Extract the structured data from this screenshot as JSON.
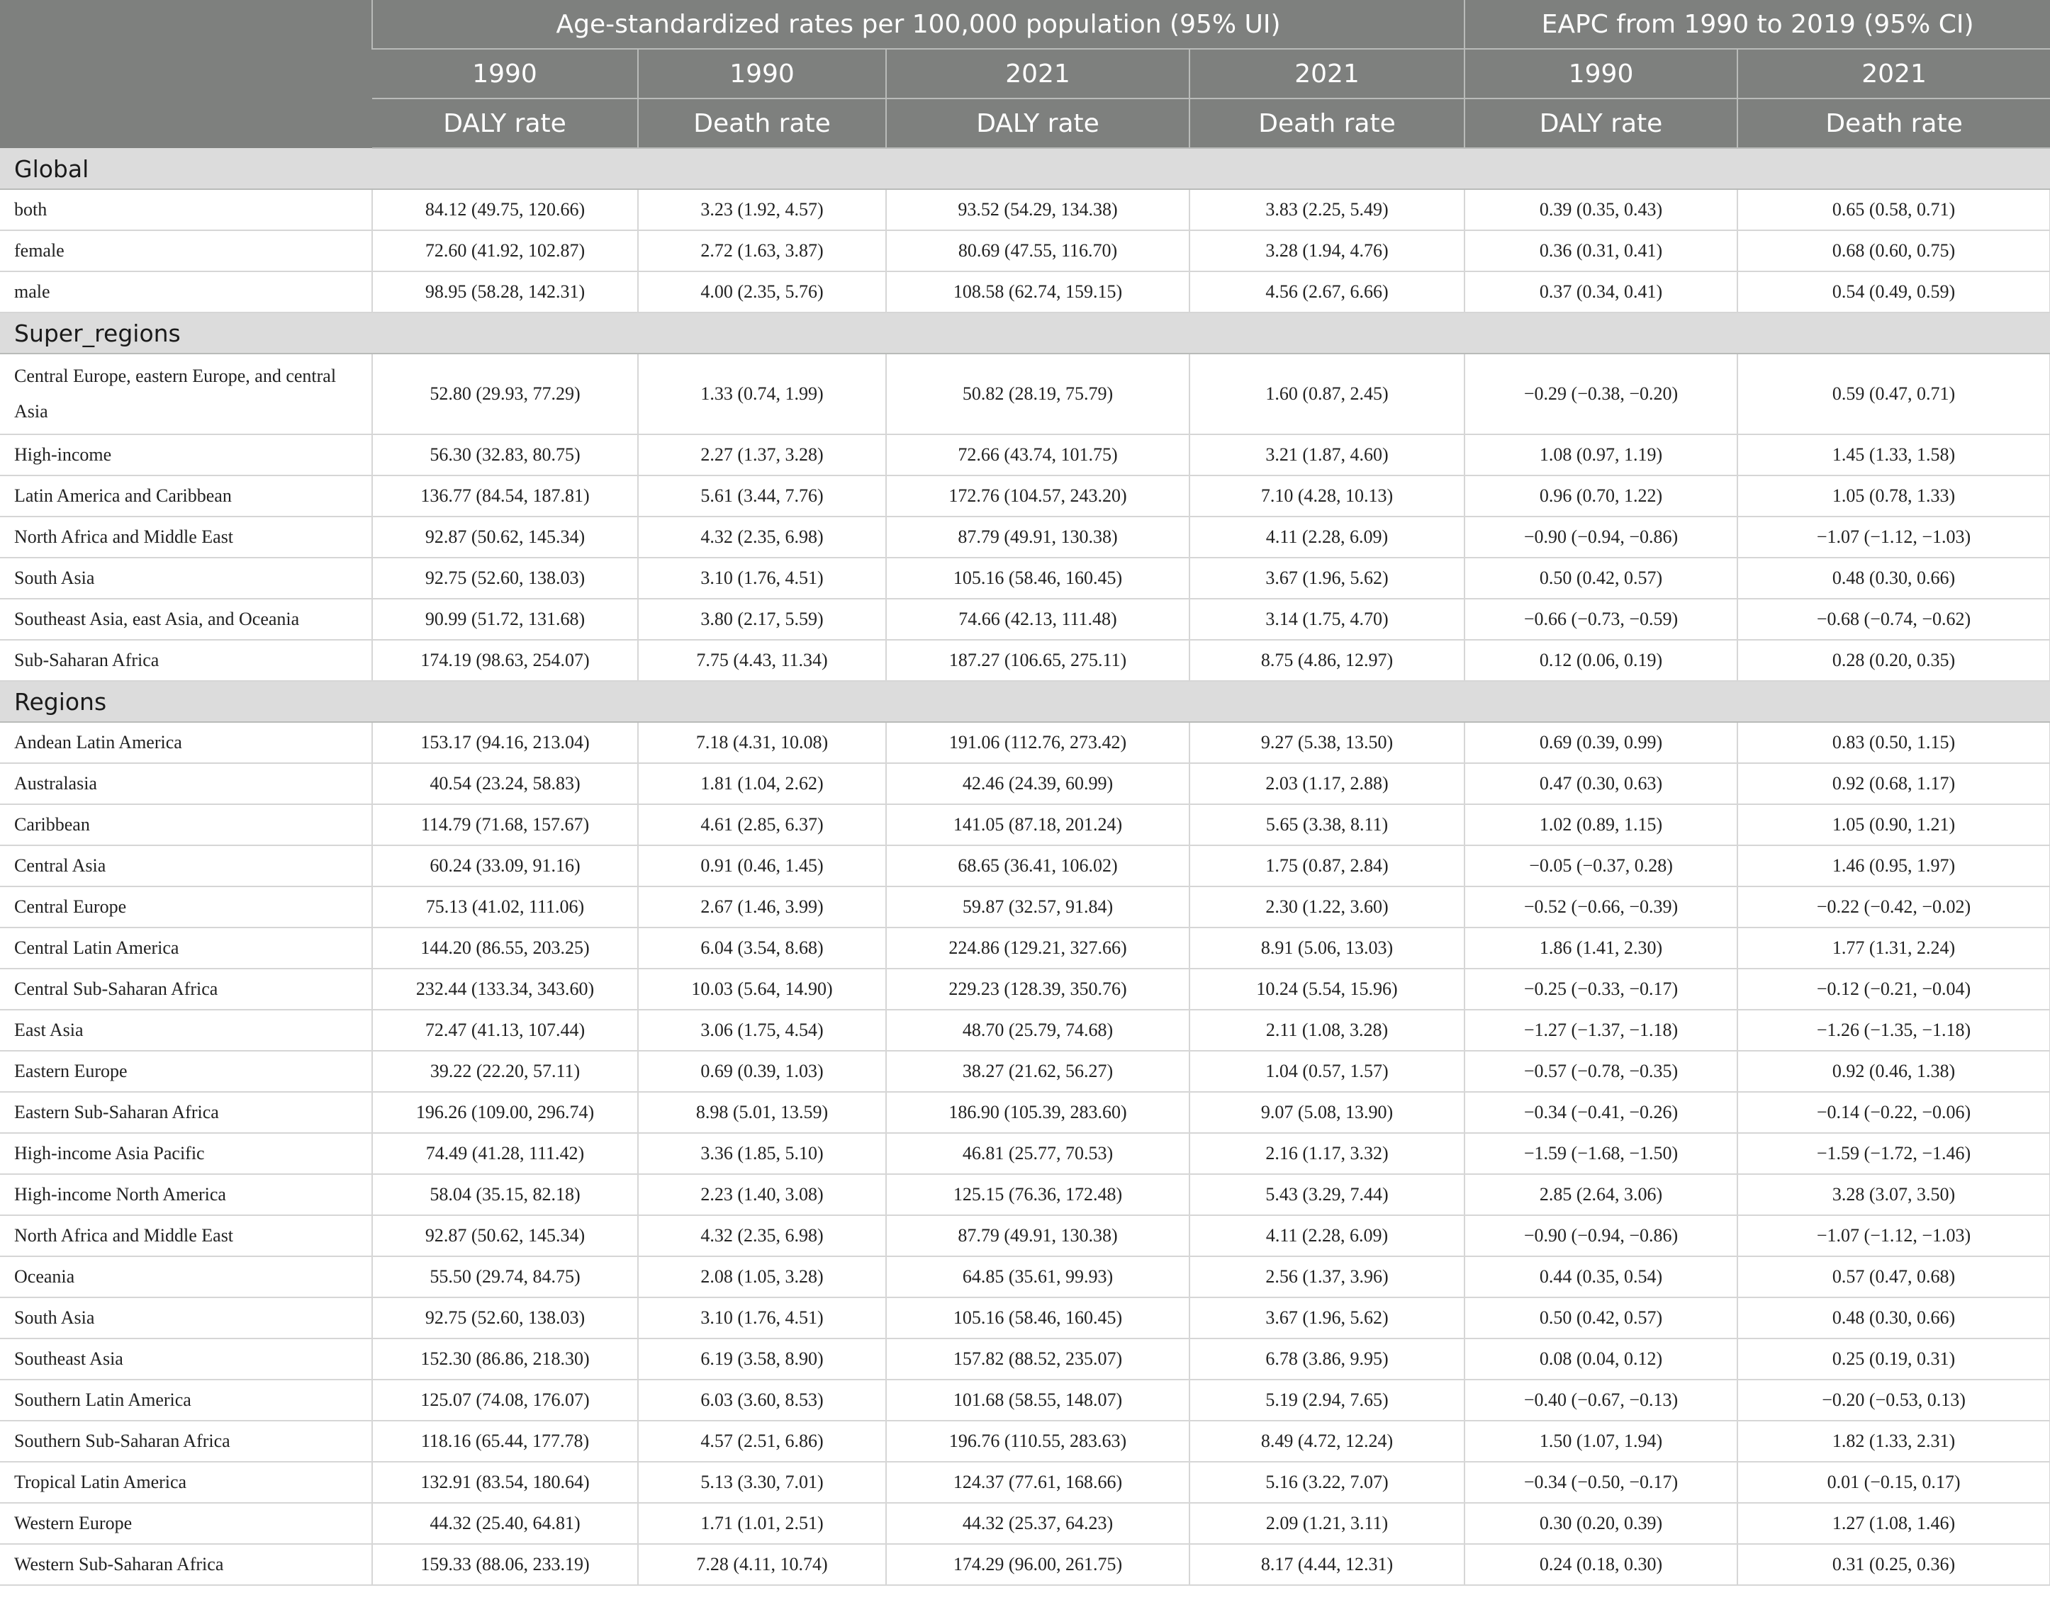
{
  "header": {
    "group_age": "Age-standardized rates per 100,000 population (95% UI)",
    "group_eapc": "EAPC from 1990 to 2019 (95% CI)",
    "years": [
      "1990",
      "1990",
      "2021",
      "2021",
      "1990",
      "2021"
    ],
    "metrics": [
      "DALY rate",
      "Death rate",
      "DALY rate",
      "Death rate",
      "DALY rate",
      "Death rate"
    ]
  },
  "sections": [
    {
      "title": "Global",
      "rows": [
        {
          "label": "both",
          "values": [
            "84.12 (49.75, 120.66)",
            "3.23 (1.92, 4.57)",
            "93.52 (54.29, 134.38)",
            "3.83 (2.25, 5.49)",
            "0.39 (0.35, 0.43)",
            "0.65 (0.58, 0.71)"
          ]
        },
        {
          "label": "female",
          "values": [
            "72.60 (41.92, 102.87)",
            "2.72 (1.63, 3.87)",
            "80.69 (47.55, 116.70)",
            "3.28 (1.94, 4.76)",
            "0.36 (0.31, 0.41)",
            "0.68 (0.60, 0.75)"
          ]
        },
        {
          "label": "male",
          "values": [
            "98.95 (58.28, 142.31)",
            "4.00 (2.35, 5.76)",
            "108.58 (62.74, 159.15)",
            "4.56 (2.67, 6.66)",
            "0.37 (0.34, 0.41)",
            "0.54 (0.49, 0.59)"
          ]
        }
      ]
    },
    {
      "title": "Super_regions",
      "rows": [
        {
          "label": "Central Europe, eastern Europe, and central Asia",
          "values": [
            "52.80 (29.93, 77.29)",
            "1.33 (0.74, 1.99)",
            "50.82 (28.19, 75.79)",
            "1.60 (0.87, 2.45)",
            "−0.29 (−0.38, −0.20)",
            "0.59 (0.47, 0.71)"
          ]
        },
        {
          "label": "High-income",
          "values": [
            "56.30 (32.83, 80.75)",
            "2.27 (1.37, 3.28)",
            "72.66 (43.74, 101.75)",
            "3.21 (1.87, 4.60)",
            "1.08 (0.97, 1.19)",
            "1.45 (1.33, 1.58)"
          ]
        },
        {
          "label": "Latin America and Caribbean",
          "values": [
            "136.77 (84.54, 187.81)",
            "5.61 (3.44, 7.76)",
            "172.76 (104.57, 243.20)",
            "7.10 (4.28, 10.13)",
            "0.96 (0.70, 1.22)",
            "1.05 (0.78, 1.33)"
          ]
        },
        {
          "label": "North Africa and Middle East",
          "values": [
            "92.87 (50.62, 145.34)",
            "4.32 (2.35, 6.98)",
            "87.79 (49.91, 130.38)",
            "4.11 (2.28, 6.09)",
            "−0.90 (−0.94, −0.86)",
            "−1.07 (−1.12, −1.03)"
          ]
        },
        {
          "label": "South Asia",
          "values": [
            "92.75 (52.60, 138.03)",
            "3.10 (1.76, 4.51)",
            "105.16 (58.46, 160.45)",
            "3.67 (1.96, 5.62)",
            "0.50 (0.42, 0.57)",
            "0.48 (0.30, 0.66)"
          ]
        },
        {
          "label": "Southeast Asia, east Asia, and Oceania",
          "values": [
            "90.99 (51.72, 131.68)",
            "3.80 (2.17, 5.59)",
            "74.66 (42.13, 111.48)",
            "3.14 (1.75, 4.70)",
            "−0.66 (−0.73, −0.59)",
            "−0.68 (−0.74, −0.62)"
          ]
        },
        {
          "label": "Sub-Saharan Africa",
          "values": [
            "174.19 (98.63, 254.07)",
            "7.75 (4.43, 11.34)",
            "187.27 (106.65, 275.11)",
            "8.75 (4.86, 12.97)",
            "0.12 (0.06, 0.19)",
            "0.28 (0.20, 0.35)"
          ]
        }
      ]
    },
    {
      "title": "Regions",
      "rows": [
        {
          "label": "Andean Latin America",
          "values": [
            "153.17 (94.16, 213.04)",
            "7.18 (4.31, 10.08)",
            "191.06 (112.76, 273.42)",
            "9.27 (5.38, 13.50)",
            "0.69 (0.39, 0.99)",
            "0.83 (0.50, 1.15)"
          ]
        },
        {
          "label": "Australasia",
          "values": [
            "40.54 (23.24, 58.83)",
            "1.81 (1.04, 2.62)",
            "42.46 (24.39, 60.99)",
            "2.03 (1.17, 2.88)",
            "0.47 (0.30, 0.63)",
            "0.92 (0.68, 1.17)"
          ]
        },
        {
          "label": "Caribbean",
          "values": [
            "114.79 (71.68, 157.67)",
            "4.61 (2.85, 6.37)",
            "141.05 (87.18, 201.24)",
            "5.65 (3.38, 8.11)",
            "1.02 (0.89, 1.15)",
            "1.05 (0.90, 1.21)"
          ]
        },
        {
          "label": "Central Asia",
          "values": [
            "60.24 (33.09, 91.16)",
            "0.91 (0.46, 1.45)",
            "68.65 (36.41, 106.02)",
            "1.75 (0.87, 2.84)",
            "−0.05 (−0.37, 0.28)",
            "1.46 (0.95, 1.97)"
          ]
        },
        {
          "label": "Central Europe",
          "values": [
            "75.13 (41.02, 111.06)",
            "2.67 (1.46, 3.99)",
            "59.87 (32.57, 91.84)",
            "2.30 (1.22, 3.60)",
            "−0.52 (−0.66, −0.39)",
            "−0.22 (−0.42, −0.02)"
          ]
        },
        {
          "label": "Central Latin America",
          "values": [
            "144.20 (86.55, 203.25)",
            "6.04 (3.54, 8.68)",
            "224.86 (129.21, 327.66)",
            "8.91 (5.06, 13.03)",
            "1.86 (1.41, 2.30)",
            "1.77 (1.31, 2.24)"
          ]
        },
        {
          "label": "Central Sub-Saharan Africa",
          "values": [
            "232.44 (133.34, 343.60)",
            "10.03 (5.64, 14.90)",
            "229.23 (128.39, 350.76)",
            "10.24 (5.54, 15.96)",
            "−0.25 (−0.33, −0.17)",
            "−0.12 (−0.21, −0.04)"
          ]
        },
        {
          "label": "East Asia",
          "values": [
            "72.47 (41.13, 107.44)",
            "3.06 (1.75, 4.54)",
            "48.70 (25.79, 74.68)",
            "2.11 (1.08, 3.28)",
            "−1.27 (−1.37, −1.18)",
            "−1.26 (−1.35, −1.18)"
          ]
        },
        {
          "label": "Eastern Europe",
          "values": [
            "39.22 (22.20, 57.11)",
            "0.69 (0.39, 1.03)",
            "38.27 (21.62, 56.27)",
            "1.04 (0.57, 1.57)",
            "−0.57 (−0.78, −0.35)",
            "0.92 (0.46, 1.38)"
          ]
        },
        {
          "label": "Eastern Sub-Saharan Africa",
          "values": [
            "196.26 (109.00, 296.74)",
            "8.98 (5.01, 13.59)",
            "186.90 (105.39, 283.60)",
            "9.07 (5.08, 13.90)",
            "−0.34 (−0.41, −0.26)",
            "−0.14 (−0.22, −0.06)"
          ]
        },
        {
          "label": "High-income Asia Pacific",
          "values": [
            "74.49 (41.28, 111.42)",
            "3.36 (1.85, 5.10)",
            "46.81 (25.77, 70.53)",
            "2.16 (1.17, 3.32)",
            "−1.59 (−1.68, −1.50)",
            "−1.59 (−1.72, −1.46)"
          ]
        },
        {
          "label": "High-income North America",
          "values": [
            "58.04 (35.15, 82.18)",
            "2.23 (1.40, 3.08)",
            "125.15 (76.36, 172.48)",
            "5.43 (3.29, 7.44)",
            "2.85 (2.64, 3.06)",
            "3.28 (3.07, 3.50)"
          ]
        },
        {
          "label": "North Africa and Middle East",
          "values": [
            "92.87 (50.62, 145.34)",
            "4.32 (2.35, 6.98)",
            "87.79 (49.91, 130.38)",
            "4.11 (2.28, 6.09)",
            "−0.90 (−0.94, −0.86)",
            "−1.07 (−1.12, −1.03)"
          ]
        },
        {
          "label": "Oceania",
          "values": [
            "55.50 (29.74, 84.75)",
            "2.08 (1.05, 3.28)",
            "64.85 (35.61, 99.93)",
            "2.56 (1.37, 3.96)",
            "0.44 (0.35, 0.54)",
            "0.57 (0.47, 0.68)"
          ]
        },
        {
          "label": "South Asia",
          "values": [
            "92.75 (52.60, 138.03)",
            "3.10 (1.76, 4.51)",
            "105.16 (58.46, 160.45)",
            "3.67 (1.96, 5.62)",
            "0.50 (0.42, 0.57)",
            "0.48 (0.30, 0.66)"
          ]
        },
        {
          "label": "Southeast Asia",
          "values": [
            "152.30 (86.86, 218.30)",
            "6.19 (3.58, 8.90)",
            "157.82 (88.52, 235.07)",
            "6.78 (3.86, 9.95)",
            "0.08 (0.04, 0.12)",
            "0.25 (0.19, 0.31)"
          ]
        },
        {
          "label": "Southern Latin America",
          "values": [
            "125.07 (74.08, 176.07)",
            "6.03 (3.60, 8.53)",
            "101.68 (58.55, 148.07)",
            "5.19 (2.94, 7.65)",
            "−0.40 (−0.67, −0.13)",
            "−0.20 (−0.53, 0.13)"
          ]
        },
        {
          "label": "Southern Sub-Saharan Africa",
          "values": [
            "118.16 (65.44, 177.78)",
            "4.57 (2.51, 6.86)",
            "196.76 (110.55, 283.63)",
            "8.49 (4.72, 12.24)",
            "1.50 (1.07, 1.94)",
            "1.82 (1.33, 2.31)"
          ]
        },
        {
          "label": "Tropical Latin America",
          "values": [
            "132.91 (83.54, 180.64)",
            "5.13 (3.30, 7.01)",
            "124.37 (77.61, 168.66)",
            "5.16 (3.22, 7.07)",
            "−0.34 (−0.50, −0.17)",
            "0.01 (−0.15, 0.17)"
          ]
        },
        {
          "label": "Western Europe",
          "values": [
            "44.32 (25.40, 64.81)",
            "1.71 (1.01, 2.51)",
            "44.32 (25.37, 64.23)",
            "2.09 (1.21, 3.11)",
            "0.30 (0.20, 0.39)",
            "1.27 (1.08, 1.46)"
          ]
        },
        {
          "label": "Western Sub-Saharan Africa",
          "values": [
            "159.33 (88.06, 233.19)",
            "7.28 (4.11, 10.74)",
            "174.29 (96.00, 261.75)",
            "8.17 (4.44, 12.31)",
            "0.24 (0.18, 0.30)",
            "0.31 (0.25, 0.36)"
          ]
        }
      ]
    }
  ]
}
